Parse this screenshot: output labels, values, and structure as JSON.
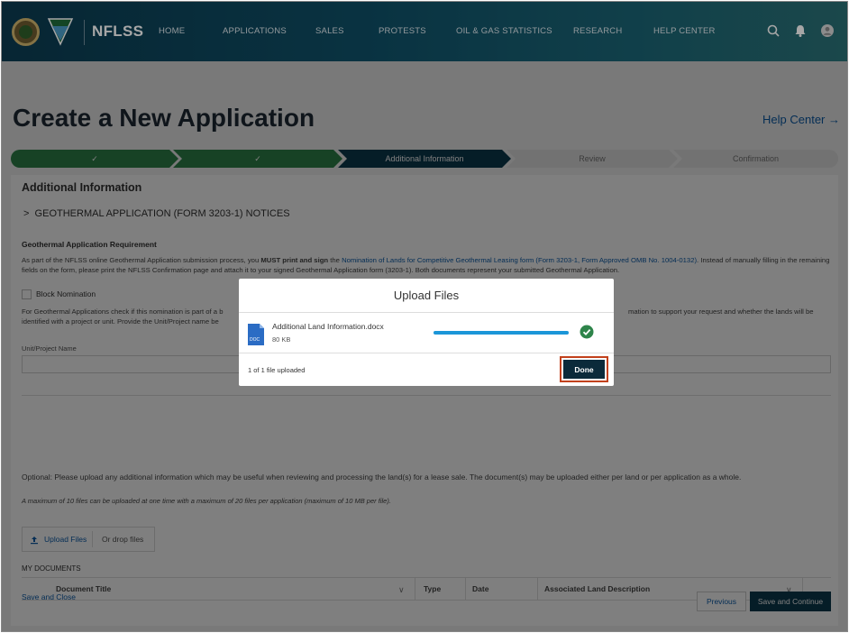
{
  "nav": {
    "brand": "NFLSS",
    "links": [
      "HOME",
      "APPLICATIONS",
      "SALES",
      "PROTESTS",
      "OIL & GAS STATISTICS",
      "RESEARCH",
      "HELP CENTER"
    ]
  },
  "page": {
    "title": "Create a New Application",
    "help_link": "Help Center →"
  },
  "steps": [
    {
      "label": "✓",
      "state": "done"
    },
    {
      "label": "✓",
      "state": "done"
    },
    {
      "label": "Additional Information",
      "state": "current"
    },
    {
      "label": "Review",
      "state": "todo"
    },
    {
      "label": "Confirmation",
      "state": "todo"
    }
  ],
  "content": {
    "section_title": "Additional Information",
    "accordion": "GEOTHERMAL APPLICATION (FORM 3203-1) NOTICES",
    "req_title": "Geothermal Application Requirement",
    "req_text_1": "As part of the NFLSS online Geothermal Application submission process, you ",
    "req_bold": "MUST print and sign",
    "req_text_2": " the ",
    "req_link": "Nomination of Lands for Competitive Geothermal Leasing form (Form 3203-1, Form Approved OMB No. 1004-0132)",
    "req_text_3": ". Instead of manually filling in the remaining fields on the form, please print the NFLSS Confirmation page and attach it to your signed Geothermal Application form (3203-1). Both documents represent your submitted Geothermal Application.",
    "block_label": "Block Nomination",
    "block_text_a": "For Geothermal Applications check if this nomination is part of a b",
    "block_text_b": "mation to support your request and whether the lands will be",
    "block_text_c": "identified with a project or unit. Provide the Unit/Project name be",
    "unit_label": "Unit/Project Name",
    "optional_text": "Optional: Please upload any additional information which may be useful when reviewing and processing the land(s) for a lease sale. The document(s) may be uploaded either per land or per application as a whole.",
    "max_text": "A maximum of 10 files can be uploaded at one time with a maximum of 20 files per application (maximum of 10 MB per file).",
    "upload_label": "Upload Files",
    "drop_label": "Or drop files",
    "docs_label": "MY DOCUMENTS",
    "table_headers": [
      "Document Title",
      "Type",
      "Date",
      "Associated Land Description"
    ]
  },
  "footer": {
    "save_close": "Save and Close",
    "previous": "Previous",
    "save_continue": "Save and Continue"
  },
  "modal": {
    "title": "Upload Files",
    "file_name": "Additional Land Information.docx",
    "file_size": "80 KB",
    "file_type": "DOC",
    "progress": 1.0,
    "count_text": "1 of 1 file uploaded",
    "done_label": "Done"
  },
  "colors": {
    "nav_bg": "#0b3a4f",
    "done_step": "#2e844a",
    "accent_button": "#0b3a4f",
    "progress": "#1b96d8",
    "success": "#2e844a",
    "highlight": "#c2411c"
  },
  "icons": [
    "doi-seal-icon",
    "blm-logo-icon",
    "search-icon",
    "bell-icon",
    "user-avatar-icon",
    "chevron-right-icon",
    "upload-icon",
    "doc-file-icon",
    "check-circle-icon",
    "chevron-down-icon"
  ]
}
